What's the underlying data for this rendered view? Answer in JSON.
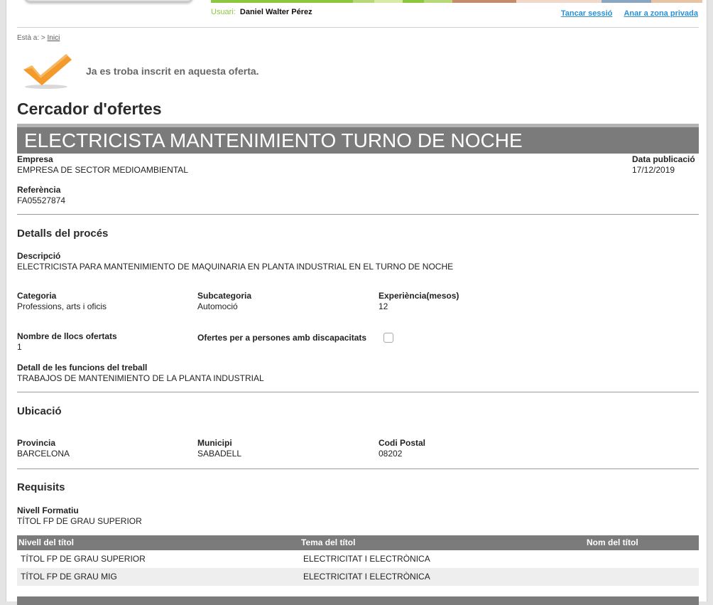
{
  "header": {
    "user_label": "Usuari:",
    "user_name": "Daniel Walter Pérez",
    "logout_link": "Tancar sessió",
    "private_link": "Anar a zona privada",
    "banner_colors": [
      "#8dc63f",
      "#b7d97a",
      "#d8eaa8",
      "#8dc63f",
      "#b7d97a",
      "#c58b6b",
      "#f0d9c8",
      "#8aa6c0",
      "#e8c4a6"
    ]
  },
  "breadcrumb": {
    "prefix": "Està a: >",
    "home": "Inici"
  },
  "notice": {
    "text": "Ja es troba inscrit en aquesta oferta.",
    "icon": "checkmark-icon",
    "icon_color": "#f39a2b"
  },
  "page": {
    "title": "Cercador d'ofertes"
  },
  "offer": {
    "title": "ELECTRICISTA MANTENIMIENTO TURNO DE NOCHE",
    "company_label": "Empresa",
    "company": "EMPRESA DE SECTOR MEDIOAMBIENTAL",
    "date_label": "Data publicació",
    "date": "17/12/2019",
    "ref_label": "Referència",
    "ref": "FA05527874"
  },
  "details": {
    "title": "Detalls del procés",
    "desc_label": "Descripció",
    "desc": "ELECTRICISTA PARA MANTENIMIENTO DE MAQUINARIA EN PLANTA INDUSTRIAL EN EL TURNO DE NOCHE",
    "category_label": "Categoria",
    "category": "Professions, arts i oficis",
    "subcategory_label": "Subcategoria",
    "subcategory": "Automoció",
    "experience_label": "Experiència(mesos)",
    "experience": "12",
    "positions_label": "Nombre de llocs ofertats",
    "positions": "1",
    "disability_label": "Ofertes per a persones amb discapacitats",
    "disability_checked": false,
    "functions_label": "Detall de les funcions del treball",
    "functions": "TRABAJOS DE MANTENIMIENTO DE LA PLANTA INDUSTRIAL"
  },
  "location": {
    "title": "Ubicació",
    "province_label": "Provincia",
    "province": "BARCELONA",
    "city_label": "Municipi",
    "city": "SABADELL",
    "postal_label": "Codi Postal",
    "postal": "08202"
  },
  "requirements": {
    "title": "Requisits",
    "level_label": "Nivell Formatiu",
    "level": "TÍTOL FP DE GRAU SUPERIOR",
    "table": {
      "headers": [
        "Nivell del títol",
        "Tema del títol",
        "Nom del títol"
      ],
      "rows": [
        [
          "TÍTOL FP DE GRAU SUPERIOR",
          "ELECTRICITAT I ELECTRÒNICA",
          ""
        ],
        [
          "TÍTOL FP DE GRAU MIG",
          "ELECTRICITAT I ELECTRÒNICA",
          ""
        ]
      ]
    }
  }
}
